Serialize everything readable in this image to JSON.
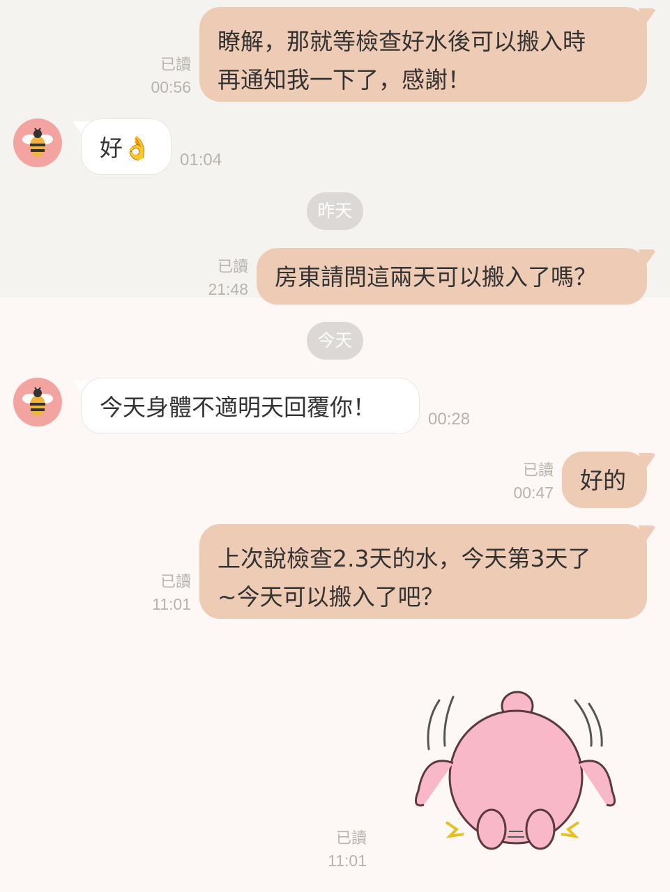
{
  "messages": [
    {
      "id": "m1",
      "text_line1": "瞭解，那就等檢查好水後可以搬入時",
      "text_line2": "再通知我一下了，感謝！",
      "read": "已讀",
      "time": "00:56"
    },
    {
      "id": "m2",
      "text": "好",
      "emoji": "👌",
      "time": "01:04"
    },
    {
      "id": "m3",
      "text": "房東請問這兩天可以搬入了嗎？",
      "read": "已讀",
      "time": "21:48"
    },
    {
      "id": "m4",
      "text": "今天身體不適明天回覆你！",
      "time": "00:28"
    },
    {
      "id": "m5",
      "text": "好的",
      "read": "已讀",
      "time": "00:47"
    },
    {
      "id": "m6",
      "text_line1": "上次說檢查2.3天的水，今天第3天了",
      "text_line2": "~今天可以搬入了吧？",
      "read": "已讀",
      "time": "11:01"
    },
    {
      "id": "m7",
      "read": "已讀",
      "time": "11:01",
      "sticker": "pink-character-pushing-sticker"
    }
  ],
  "dividers": {
    "yesterday": "昨天",
    "today": "今天"
  },
  "colors": {
    "outgoing_bubble": "#eecbb5",
    "incoming_bubble": "#ffffff",
    "avatar_bg": "#f4a4a0",
    "divider_bg": "#dcd8d5",
    "meta_text": "#b9b3ae"
  }
}
